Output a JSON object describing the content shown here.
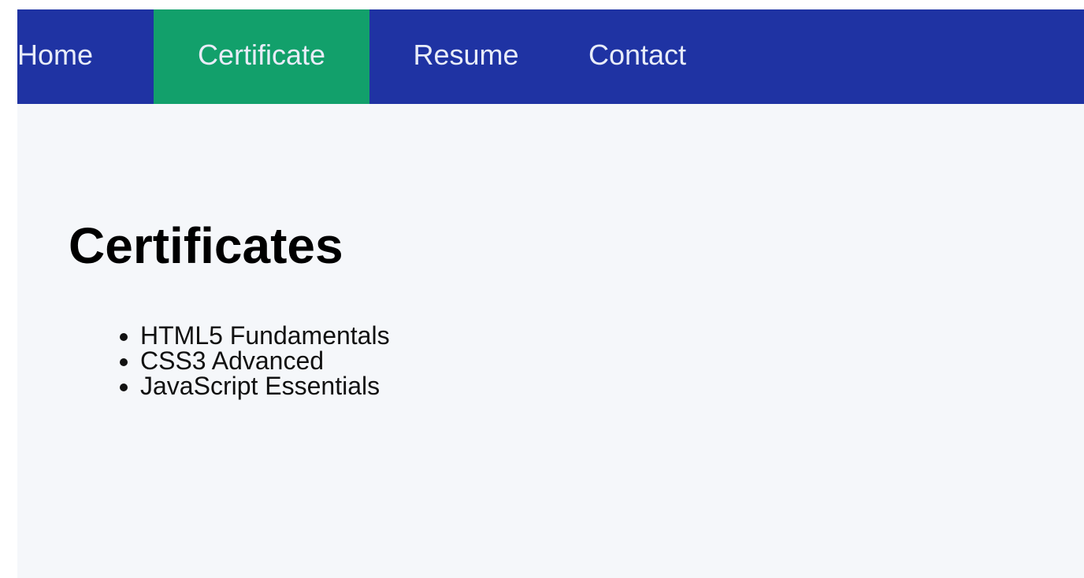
{
  "nav": {
    "items": [
      {
        "label": "Home",
        "active": false
      },
      {
        "label": "Certificate",
        "active": true
      },
      {
        "label": "Resume",
        "active": false
      },
      {
        "label": "Contact",
        "active": false
      }
    ]
  },
  "main": {
    "title": "Certificates",
    "certificates": [
      "HTML5 Fundamentals",
      "CSS3 Advanced",
      "JavaScript Essentials"
    ]
  },
  "colors": {
    "nav_background": "#1f33a3",
    "nav_active": "#12a06b",
    "page_background": "#f5f7fa"
  }
}
